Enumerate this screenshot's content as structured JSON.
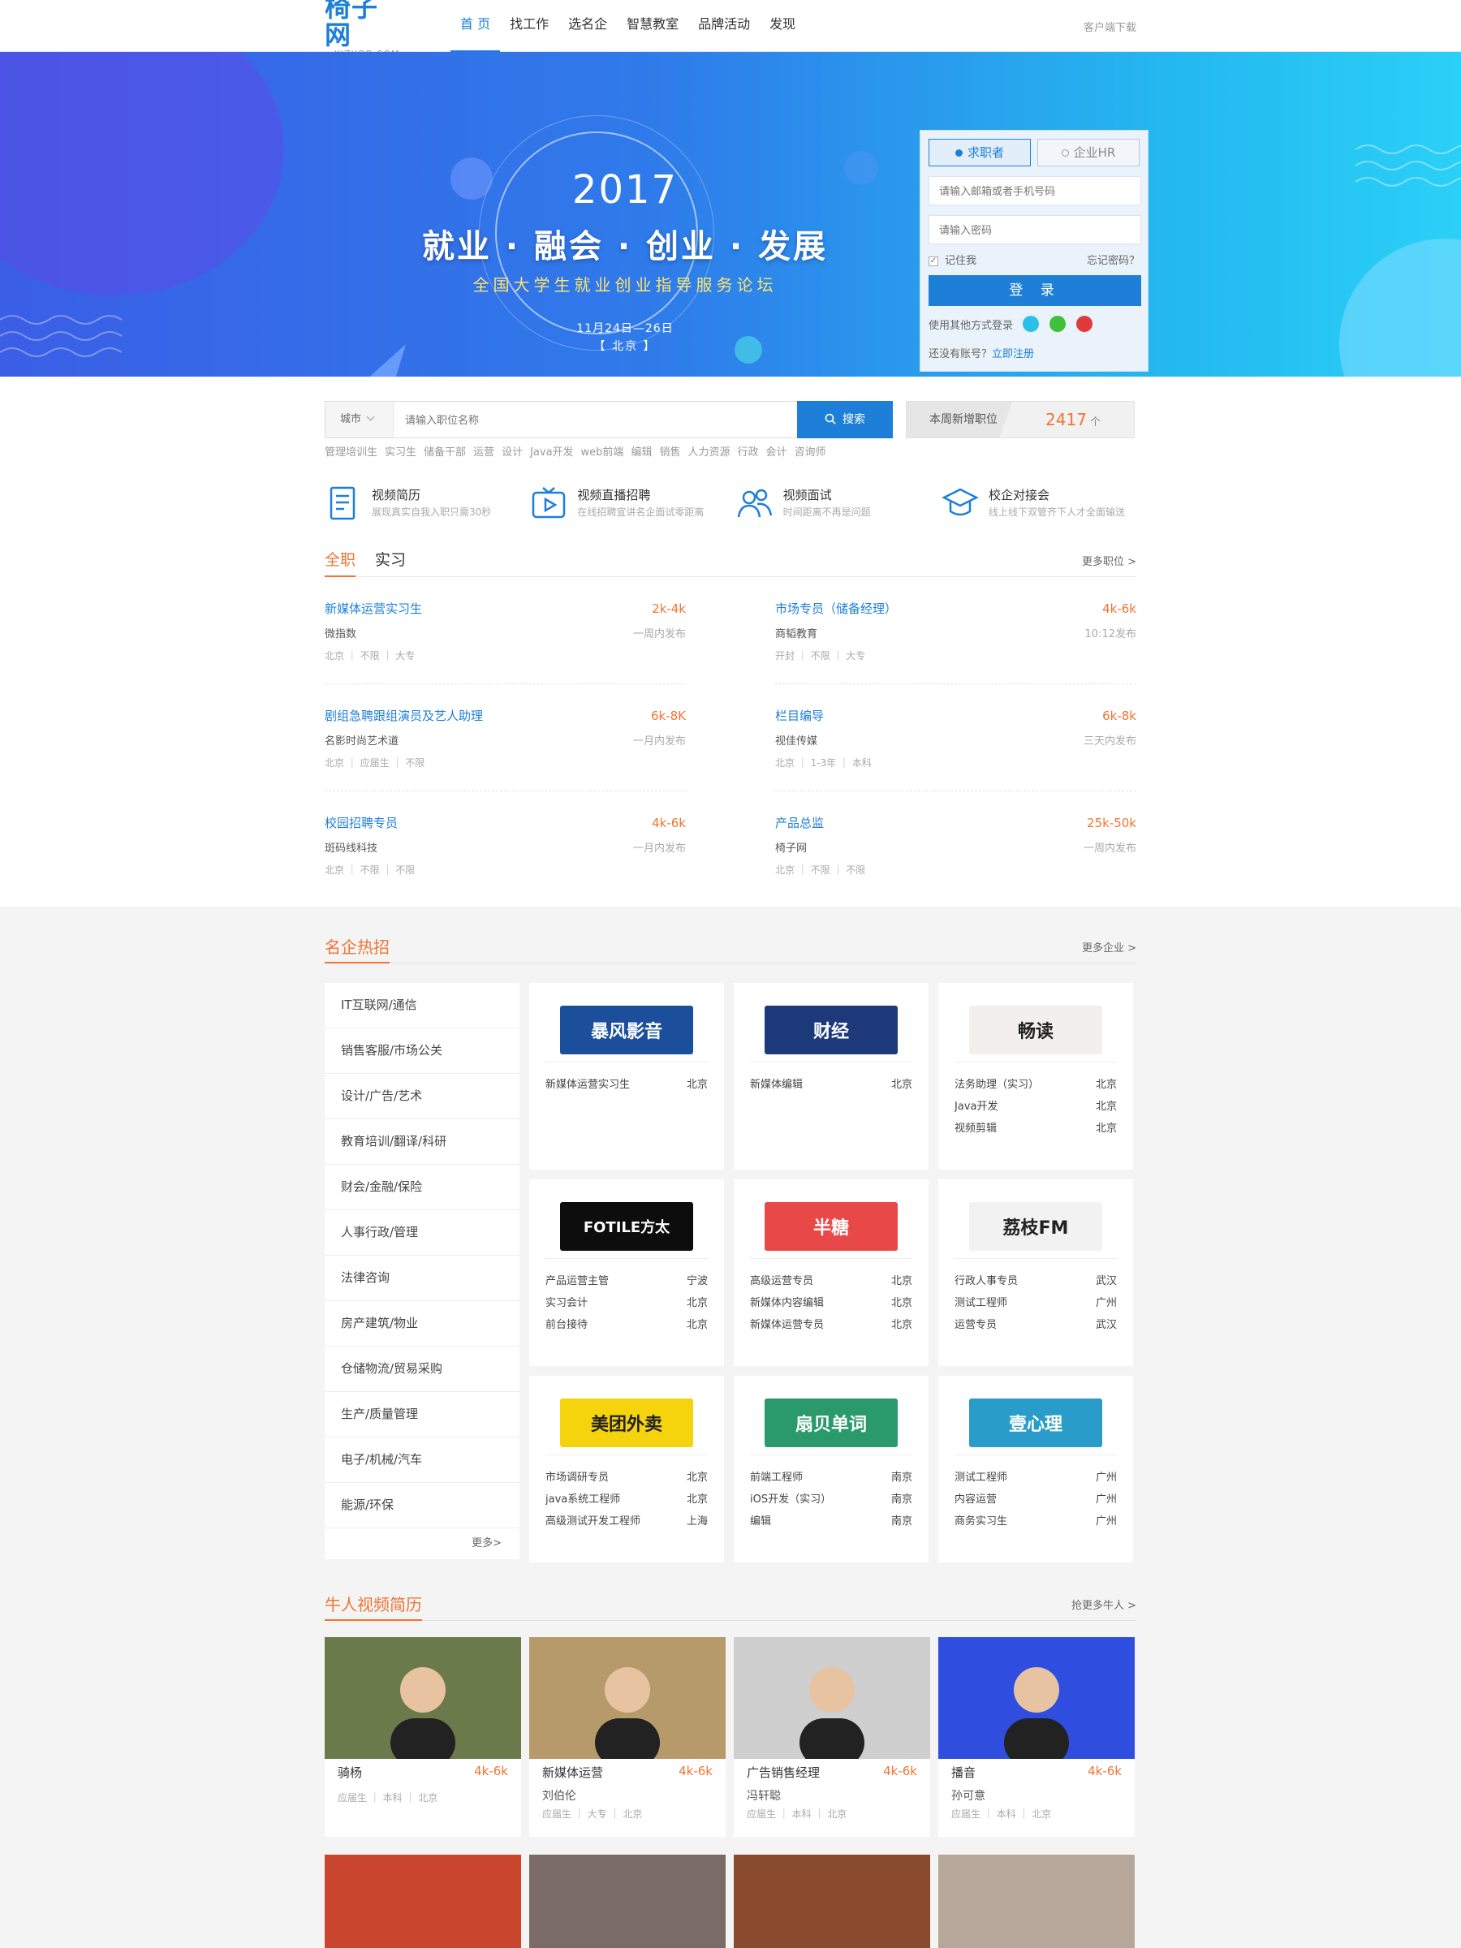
{
  "header": {
    "logo": "椅子网",
    "logo_sub": "YIZIJOB.COM",
    "nav": [
      "首 页",
      "找工作",
      "选名企",
      "智慧教室",
      "品牌活动",
      "发现"
    ],
    "client_download": "客户端下载"
  },
  "banner": {
    "year": "2017",
    "slogan": "就业 · 融会 · 创业 · 发展",
    "subtitle": "全国大学生就业创业指导服务论坛",
    "date": "11月24日—26日",
    "place": "【 北京 】",
    "active_slide": 2,
    "slide_count": 6
  },
  "login": {
    "role_seeker": "求职者",
    "role_hr": "企业HR",
    "account_placeholder": "请输入邮箱或者手机号码",
    "password_placeholder": "请输入密码",
    "remember": "记住我",
    "forgot": "忘记密码？",
    "login_button": "登 录",
    "other_login": "使用其他方式登录",
    "no_account": "还没有账号？",
    "register": "立即注册"
  },
  "search": {
    "city": "城市",
    "placeholder": "请输入职位名称",
    "button": "搜索",
    "new_jobs_label": "本周新增职位",
    "new_jobs_count": "2417",
    "new_jobs_unit": "个",
    "hot_keywords": [
      "管理培训生",
      "实习生",
      "储备干部",
      "运营",
      "设计",
      "Java开发",
      "web前端",
      "编辑",
      "销售",
      "人力资源",
      "行政",
      "会计",
      "咨询师"
    ]
  },
  "features": [
    {
      "icon": "resume-icon",
      "title": "视频简历",
      "desc": "展现真实自我入职只需30秒"
    },
    {
      "icon": "play-video-icon",
      "title": "视频直播招聘",
      "desc": "在线招聘宣讲名企面试零距离"
    },
    {
      "icon": "people-icon",
      "title": "视频面试",
      "desc": "时间距离不再是问题"
    },
    {
      "icon": "graduation-cap-icon",
      "title": "校企对接会",
      "desc": "线上线下双管齐下人才全面输送"
    }
  ],
  "jobs_section": {
    "tabs": [
      "全职",
      "实习"
    ],
    "more": "更多职位 >",
    "jobs": [
      {
        "title": "新媒体运营实习生",
        "salary": "2k-4k",
        "company": "微指数",
        "time": "一周内发布",
        "meta": "北京 ｜ 不限 ｜ 大专"
      },
      {
        "title": "市场专员（储备经理）",
        "salary": "4k-6k",
        "company": "商韬教育",
        "time": "10:12发布",
        "meta": "开封 ｜ 不限 ｜ 大专"
      },
      {
        "title": "剧组急聘跟组演员及艺人助理",
        "salary": "6k-8K",
        "company": "名影时尚艺术道",
        "time": "一月内发布",
        "meta": "北京 ｜ 应届生 ｜ 不限"
      },
      {
        "title": "栏目编导",
        "salary": "6k-8k",
        "company": "视佳传媒",
        "time": "三天内发布",
        "meta": "北京 ｜ 1-3年 ｜ 本科"
      },
      {
        "title": "校园招聘专员",
        "salary": "4k-6k",
        "company": "斑码线科技",
        "time": "一月内发布",
        "meta": "北京 ｜ 不限 ｜ 不限"
      },
      {
        "title": "产品总监",
        "salary": "25k-50k",
        "company": "椅子网",
        "time": "一周内发布",
        "meta": "北京 ｜ 不限 ｜ 不限"
      }
    ]
  },
  "companies_section": {
    "title": "名企热招",
    "more": "更多企业 >",
    "categories": [
      "IT互联网/通信",
      "销售客服/市场公关",
      "设计/广告/艺术",
      "教育培训/翻译/科研",
      "财会/金融/保险",
      "人事行政/管理",
      "法律咨询",
      "房产建筑/物业",
      "仓储物流/贸易采购",
      "生产/质量管理",
      "电子/机械/汽车",
      "能源/环保"
    ],
    "categories_more": "更多>",
    "cards": [
      {
        "logo_text": "暴风影音",
        "logo_bg": "#1b4f9c",
        "logo_color": "#ffffff",
        "jobs": [
          {
            "t": "新媒体运营实习生",
            "c": "北京"
          }
        ]
      },
      {
        "logo_text": "财经",
        "logo_bg": "#1c3a7a",
        "logo_color": "#ffffff",
        "jobs": [
          {
            "t": "新媒体编辑",
            "c": "北京"
          }
        ]
      },
      {
        "logo_text": "畅读",
        "logo_bg": "#f2efee",
        "logo_color": "#222222",
        "jobs": [
          {
            "t": "法务助理（实习）",
            "c": "北京"
          },
          {
            "t": "Java开发",
            "c": "北京"
          },
          {
            "t": "视频剪辑",
            "c": "北京"
          }
        ]
      },
      {
        "logo_text": "FOTILE方太",
        "logo_bg": "#0d0d0d",
        "logo_color": "#ffffff",
        "jobs": [
          {
            "t": "产品运营主管",
            "c": "宁波"
          },
          {
            "t": "实习会计",
            "c": "北京"
          },
          {
            "t": "前台接待",
            "c": "北京"
          }
        ]
      },
      {
        "logo_text": "半糖",
        "logo_bg": "#e84848",
        "logo_color": "#ffffff",
        "jobs": [
          {
            "t": "高级运营专员",
            "c": "北京"
          },
          {
            "t": "新媒体内容编辑",
            "c": "北京"
          },
          {
            "t": "新媒体运营专员",
            "c": "北京"
          }
        ]
      },
      {
        "logo_text": "荔枝FM",
        "logo_bg": "#f2f2f2",
        "logo_color": "#222222",
        "jobs": [
          {
            "t": "行政人事专员",
            "c": "武汉"
          },
          {
            "t": "测试工程师",
            "c": "广州"
          },
          {
            "t": "运营专员",
            "c": "武汉"
          }
        ]
      },
      {
        "logo_text": "美团外卖",
        "logo_bg": "#f5d30d",
        "logo_color": "#222222",
        "jobs": [
          {
            "t": "市场调研专员",
            "c": "北京"
          },
          {
            "t": "java系统工程师",
            "c": "北京"
          },
          {
            "t": "高级测试开发工程师",
            "c": "上海"
          }
        ]
      },
      {
        "logo_text": "扇贝单词",
        "logo_bg": "#2a9a6c",
        "logo_color": "#ffffff",
        "jobs": [
          {
            "t": "前端工程师",
            "c": "南京"
          },
          {
            "t": "iOS开发（实习）",
            "c": "南京"
          },
          {
            "t": "编辑",
            "c": "南京"
          }
        ]
      },
      {
        "logo_text": "壹心理",
        "logo_bg": "#2a9cc9",
        "logo_color": "#ffffff",
        "jobs": [
          {
            "t": "测试工程师",
            "c": "广州"
          },
          {
            "t": "内容运营",
            "c": "广州"
          },
          {
            "t": "商务实习生",
            "c": "广州"
          }
        ]
      }
    ]
  },
  "talent_section": {
    "title": "牛人视频简历",
    "more": "抢更多牛人 >",
    "people": [
      {
        "role": "骑杨",
        "salary": "4k-6k",
        "name": "",
        "meta": "应届生 ｜ 本科 ｜ 北京",
        "bg": "#6b7a4a"
      },
      {
        "role": "新媒体运营",
        "salary": "4k-6k",
        "name": "刘伯伦",
        "meta": "应届生 ｜ 大专 ｜ 北京",
        "bg": "#b79a6a"
      },
      {
        "role": "广告销售经理",
        "salary": "4k-6k",
        "name": "冯轩聪",
        "meta": "应届生 ｜ 本科 ｜ 北京",
        "bg": "#cfcfcf"
      },
      {
        "role": "播音",
        "salary": "4k-6k",
        "name": "孙可意",
        "meta": "应届生 ｜ 本科 ｜ 北京",
        "bg": "#2f4ee0"
      }
    ],
    "bottom_bgs": [
      "#c9452e",
      "#7a6a68",
      "#8a4a2e",
      "#b7a69a"
    ]
  },
  "colors": {
    "brand_blue": "#1e7fd8",
    "accent_orange": "#f07432"
  }
}
